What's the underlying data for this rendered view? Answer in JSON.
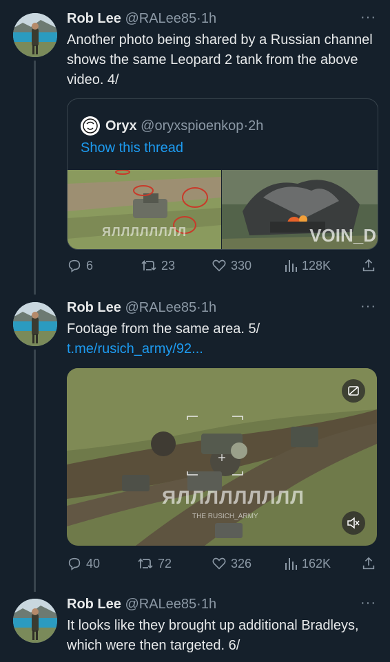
{
  "tweets": [
    {
      "name": "Rob Lee",
      "handle": "@RALee85",
      "dot": "·",
      "time": "1h",
      "more": "···",
      "text": "Another photo being shared by a Russian channel shows the same Leopard 2 tank from the above video. 4/",
      "quote": {
        "name": "Oryx",
        "handle": "@oryxspioenkop",
        "dot": "·",
        "time": "2h",
        "show_thread": "Show this thread",
        "watermark_left": "ЯЛЛЛЛЛЛЛЛ",
        "watermark_right": "VOIN_D"
      },
      "stats": {
        "replies": "6",
        "retweets": "23",
        "likes": "330",
        "views": "128K"
      }
    },
    {
      "name": "Rob Lee",
      "handle": "@RALee85",
      "dot": "·",
      "time": "1h",
      "more": "···",
      "text": "Footage from the same area. 5/",
      "link": "t.me/rusich_army/92...",
      "media_watermark": "ЯЛЛЛЛЛЛЛЛЛ",
      "media_caption": "THE RUSICH_ARMY",
      "stats": {
        "replies": "40",
        "retweets": "72",
        "likes": "326",
        "views": "162K"
      }
    },
    {
      "name": "Rob Lee",
      "handle": "@RALee85",
      "dot": "·",
      "time": "1h",
      "more": "···",
      "text": "It looks like they brought up additional Bradleys, which were then targeted. 6/"
    }
  ],
  "colors": {
    "background": "#15202b",
    "link": "#1d9bf0",
    "muted": "#8b98a5",
    "border": "#38444d"
  },
  "icons": [
    "reply-icon",
    "retweet-icon",
    "like-icon",
    "views-icon",
    "share-icon",
    "gif-icon",
    "mute-icon"
  ]
}
